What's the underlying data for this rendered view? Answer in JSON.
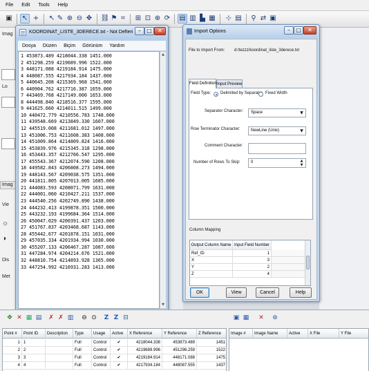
{
  "app": {
    "menu": [
      "File",
      "Edit",
      "Tools",
      "Help"
    ]
  },
  "left_panel": {
    "labels": [
      "Imag",
      "Lo",
      "Imag",
      "Vie",
      "Dis",
      "Met"
    ]
  },
  "notepad": {
    "title": "KOORDINAT_LISTE_3DERECE.txt - Not Defteri",
    "menu": [
      "Dosya",
      "Düzen",
      "Biçim",
      "Görünüm",
      "Yardım"
    ],
    "rows": [
      [
        1,
        "453873.489",
        "4218044.338",
        "1451.000"
      ],
      [
        2,
        "451298.259",
        "4219689.996",
        "1522.000"
      ],
      [
        3,
        "448171.088",
        "4219184.914",
        "1475.000"
      ],
      [
        4,
        "448087.555",
        "4217934.184",
        "1437.000"
      ],
      [
        5,
        "440645.208",
        "4215369.968",
        "1541.000"
      ],
      [
        6,
        "440904.762",
        "4217716.387",
        "1659.000"
      ],
      [
        7,
        "443469.768",
        "4217149.000",
        "1653.000"
      ],
      [
        8,
        "444498.840",
        "4218516.377",
        "1595.000"
      ],
      [
        9,
        "441625.660",
        "4214011.515",
        "1499.000"
      ],
      [
        10,
        "440472.779",
        "4210556.783",
        "1748.000"
      ],
      [
        11,
        "439548.669",
        "4213849.330",
        "1607.000"
      ],
      [
        12,
        "445519.008",
        "4211681.012",
        "1497.000"
      ],
      [
        13,
        "451006.753",
        "4211608.383",
        "1408.000"
      ],
      [
        14,
        "451009.864",
        "4214809.824",
        "1416.000"
      ],
      [
        15,
        "453839.976",
        "4215345.318",
        "1298.000"
      ],
      [
        16,
        "453443.357",
        "4212766.547",
        "1295.000"
      ],
      [
        17,
        "455543.367",
        "4212074.590",
        "1208.000"
      ],
      [
        18,
        "449582.843",
        "4206808.273",
        "1494.000"
      ],
      [
        19,
        "448143.567",
        "4209038.575",
        "1351.000"
      ],
      [
        20,
        "441811.805",
        "4207013.005",
        "1685.000"
      ],
      [
        21,
        "444083.593",
        "4208071.799",
        "1631.000"
      ],
      [
        22,
        "444001.060",
        "4210427.211",
        "1537.000"
      ],
      [
        23,
        "444540.256",
        "4202749.890",
        "1438.000"
      ],
      [
        24,
        "444232.413",
        "4199878.351",
        "1500.000"
      ],
      [
        25,
        "443232.193",
        "4199684.364",
        "1514.000"
      ],
      [
        26,
        "450047.029",
        "4200391.437",
        "1203.000"
      ],
      [
        27,
        "451767.837",
        "4203468.687",
        "1143.000"
      ],
      [
        28,
        "455442.677",
        "4201878.151",
        "1031.000"
      ],
      [
        29,
        "457035.334",
        "4201934.994",
        "1030.000"
      ],
      [
        30,
        "455207.133",
        "4206467.287",
        "1087.000"
      ],
      [
        31,
        "447284.974",
        "4204214.676",
        "1521.000"
      ],
      [
        32,
        "448810.754",
        "4214893.928",
        "1365.000"
      ],
      [
        33,
        "447254.992",
        "4216931.283",
        "1413.000"
      ]
    ]
  },
  "import_options": {
    "title": "Import Options",
    "file_label": "File to Import From:",
    "file_path": "d:/tezzz/koordinat_liste_3derece.txt",
    "tabs": [
      "Field Definition",
      "Input Preview"
    ],
    "field_type_label": "Field Type:",
    "field_type_options": [
      "Delimited by Separator",
      "Fixed Width"
    ],
    "separator_label": "Separator Character:",
    "separator_value": "Space",
    "row_terminator_label": "Row Terminator Character:",
    "row_terminator_value": "NewLine (Unix)",
    "comment_label": "Comment Character:",
    "comment_value": "",
    "skip_label": "Number of Rows To Skip:",
    "skip_value": "0",
    "column_mapping_label": "Column Mapping",
    "mapping_headers": [
      "Output Column Name",
      "Input Field Number"
    ],
    "mapping_rows": [
      {
        "name": "Ref_ID",
        "field": "1"
      },
      {
        "name": "X",
        "field": "3"
      },
      {
        "name": "Y",
        "field": "2"
      },
      {
        "name": "Z",
        "field": "4"
      }
    ],
    "buttons": {
      "ok": "OK",
      "view": "View",
      "cancel": "Cancel",
      "help": "Help"
    }
  },
  "gcp_table": {
    "headers": [
      "Point #",
      "Point ID",
      "Description",
      "Type",
      "Usage",
      "Active",
      "X Reference",
      "Y Reference",
      "Z Reference"
    ],
    "rows": [
      [
        "1",
        "1",
        "",
        "Full",
        "Control",
        "✔",
        "4218044.338",
        "453873.489",
        "1451"
      ],
      [
        "2",
        "2",
        "",
        "Full",
        "Control",
        "✔",
        "4219689.996",
        "451298.259",
        "1522"
      ],
      [
        "3",
        "3",
        "",
        "Full",
        "Control",
        "✔",
        "4219184.914",
        "448171.088",
        "1475"
      ],
      [
        "4",
        "4",
        "",
        "Full",
        "Control",
        "✔",
        "4217934.184",
        "448087.555",
        "1437"
      ]
    ]
  },
  "image_table": {
    "headers": [
      "Image #",
      "Image Name",
      "Active",
      "X File",
      "Y File"
    ]
  }
}
